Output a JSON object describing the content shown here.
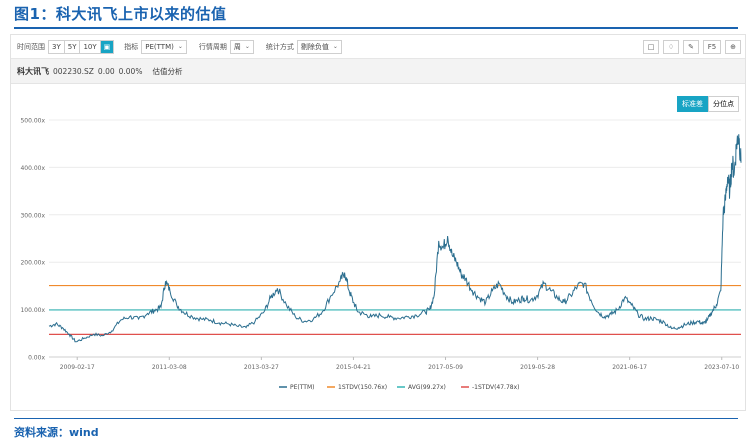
{
  "figure": {
    "title": "图1：科大讯飞上市以来的估值",
    "source": "资料来源：wind"
  },
  "toolbar": {
    "time_range_label": "时间范围",
    "range_options": [
      "3Y",
      "5Y",
      "10Y"
    ],
    "indicator_label": "指标",
    "indicator_value": "PE(TTM)",
    "period_label": "行情周期",
    "period_value": "周",
    "stat_label": "统计方式",
    "stat_value": "剔除负值",
    "right_buttons": [
      "F5"
    ]
  },
  "stock": {
    "name": "科大讯飞",
    "code": "002230.SZ",
    "price": "0.00",
    "change": "0.00%",
    "tab": "估值分析"
  },
  "modes": [
    "标准差",
    "分位点"
  ],
  "colors": {
    "pe": "#2b6e8f",
    "plus1": "#f08a2c",
    "avg": "#35b6b6",
    "minus1": "#e0504d",
    "accent": "#18a4c4",
    "title": "#1a63b0"
  },
  "chart_data": {
    "type": "line",
    "y_ticks": [
      "0.00x",
      "100.00x",
      "200.00x",
      "300.00x",
      "400.00x",
      "500.00x"
    ],
    "x_ticks": [
      "2009-02-17",
      "2011-03-08",
      "2013-03-27",
      "2015-04-21",
      "2017-05-09",
      "2019-05-28",
      "2021-06-17",
      "2023-07-10"
    ],
    "ylim": [
      0,
      500
    ],
    "xlim": [
      2008.5,
      2023.95
    ],
    "grid": "horizontal",
    "legend_position": "bottom",
    "reference_lines": [
      {
        "name": "1STDV(150.76x)",
        "value": 150.76
      },
      {
        "name": "AVG(99.27x)",
        "value": 99.27
      },
      {
        "name": "-1STDV(47.78x)",
        "value": 47.78
      }
    ],
    "series": [
      {
        "name": "PE(TTM)",
        "x": [
          2008.5,
          2008.65,
          2008.8,
          2008.95,
          2009.1,
          2009.3,
          2009.5,
          2009.7,
          2009.9,
          2010.1,
          2010.3,
          2010.5,
          2010.7,
          2010.85,
          2011.0,
          2011.1,
          2011.2,
          2011.35,
          2011.5,
          2011.7,
          2011.9,
          2012.1,
          2012.3,
          2012.5,
          2012.7,
          2012.9,
          2013.1,
          2013.3,
          2013.45,
          2013.6,
          2013.8,
          2014.0,
          2014.2,
          2014.4,
          2014.6,
          2014.8,
          2015.0,
          2015.1,
          2015.2,
          2015.3,
          2015.4,
          2015.55,
          2015.7,
          2015.9,
          2016.1,
          2016.3,
          2016.5,
          2016.7,
          2016.9,
          2017.0,
          2017.1,
          2017.2,
          2017.3,
          2017.4,
          2017.5,
          2017.6,
          2017.7,
          2017.8,
          2017.95,
          2018.1,
          2018.25,
          2018.4,
          2018.55,
          2018.7,
          2018.85,
          2019.0,
          2019.1,
          2019.25,
          2019.4,
          2019.55,
          2019.7,
          2019.85,
          2020.0,
          2020.15,
          2020.3,
          2020.45,
          2020.6,
          2020.75,
          2020.9,
          2021.05,
          2021.2,
          2021.35,
          2021.5,
          2021.65,
          2021.8,
          2021.95,
          2022.1,
          2022.25,
          2022.4,
          2022.55,
          2022.7,
          2022.85,
          2023.0,
          2023.1,
          2023.2,
          2023.3,
          2023.4,
          2023.5,
          2023.55,
          2023.6,
          2023.65,
          2023.7,
          2023.75,
          2023.8,
          2023.85,
          2023.9,
          2023.95
        ],
        "values": [
          65,
          70,
          62,
          48,
          32,
          40,
          48,
          45,
          55,
          78,
          85,
          80,
          92,
          98,
          105,
          160,
          140,
          110,
          95,
          85,
          80,
          78,
          72,
          70,
          65,
          62,
          75,
          95,
          125,
          145,
          110,
          85,
          75,
          80,
          95,
          130,
          160,
          178,
          140,
          115,
          95,
          90,
          85,
          88,
          84,
          82,
          85,
          88,
          95,
          100,
          130,
          245,
          230,
          255,
          215,
          200,
          175,
          165,
          140,
          125,
          115,
          140,
          155,
          130,
          115,
          120,
          125,
          120,
          130,
          155,
          140,
          125,
          115,
          130,
          150,
          155,
          120,
          95,
          85,
          90,
          100,
          125,
          110,
          90,
          80,
          82,
          78,
          72,
          60,
          62,
          68,
          72,
          75,
          70,
          78,
          95,
          110,
          140,
          300,
          330,
          380,
          350,
          410,
          390,
          450,
          470,
          410
        ]
      }
    ]
  }
}
